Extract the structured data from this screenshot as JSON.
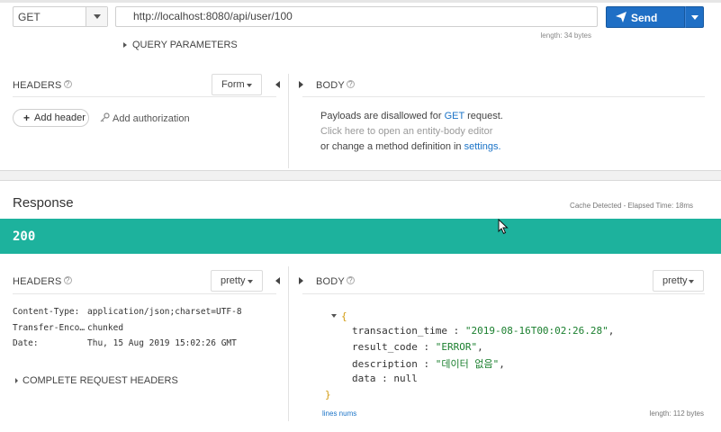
{
  "request": {
    "method": "GET",
    "url": "http://localhost:8080/api/user/100",
    "url_length": "length: 34 bytes",
    "send_label": "Send",
    "query_parameters_label": "QUERY PARAMETERS",
    "headers": {
      "title": "HEADERS",
      "help": "?",
      "mode": "Form",
      "add_header_label": "Add header",
      "add_authorization_label": "Add authorization"
    },
    "body": {
      "title": "BODY",
      "help": "?",
      "message_prefix": "Payloads are disallowed for",
      "method_link": "GET",
      "message_suffix": "request.",
      "editor_hint": "Click here to open an entity-body editor",
      "change_prefix": "or change a method definition in",
      "settings_link": "settings",
      "change_suffix": "."
    }
  },
  "response": {
    "title": "Response",
    "meta": "Cache Detected - Elapsed Time: 18ms",
    "status_code": "200",
    "status_color": "#1db29d",
    "headers": {
      "title": "HEADERS",
      "help": "?",
      "mode": "pretty",
      "rows": [
        {
          "name": "Content-Type:",
          "value": "application/json;charset=UTF-8"
        },
        {
          "name": "Transfer-Enco…",
          "value": "chunked"
        },
        {
          "name": "Date:",
          "value": "Thu, 15 Aug 2019 15:02:26 GMT"
        }
      ],
      "complete_label": "COMPLETE REQUEST HEADERS"
    },
    "body": {
      "title": "BODY",
      "help": "?",
      "mode": "pretty",
      "open_brace": "{",
      "close_brace": "}",
      "fields": [
        {
          "key": "transaction_time",
          "value": "\"2019-08-16T00:02:26.28\"",
          "comma": ","
        },
        {
          "key": "result_code",
          "value": "\"ERROR\"",
          "comma": ","
        },
        {
          "key": "description",
          "value": "\"데이터 없음\"",
          "comma": ","
        },
        {
          "key": "data",
          "value": "null",
          "comma": ""
        }
      ],
      "lines_nums_label": "lines nums",
      "length": "length: 112 bytes"
    }
  },
  "icons": [
    "caret-down-icon",
    "send-icon",
    "plus-icon",
    "key-icon",
    "chevron-left-icon",
    "chevron-right-icon",
    "collapse-icon",
    "mouse-cursor-icon"
  ]
}
